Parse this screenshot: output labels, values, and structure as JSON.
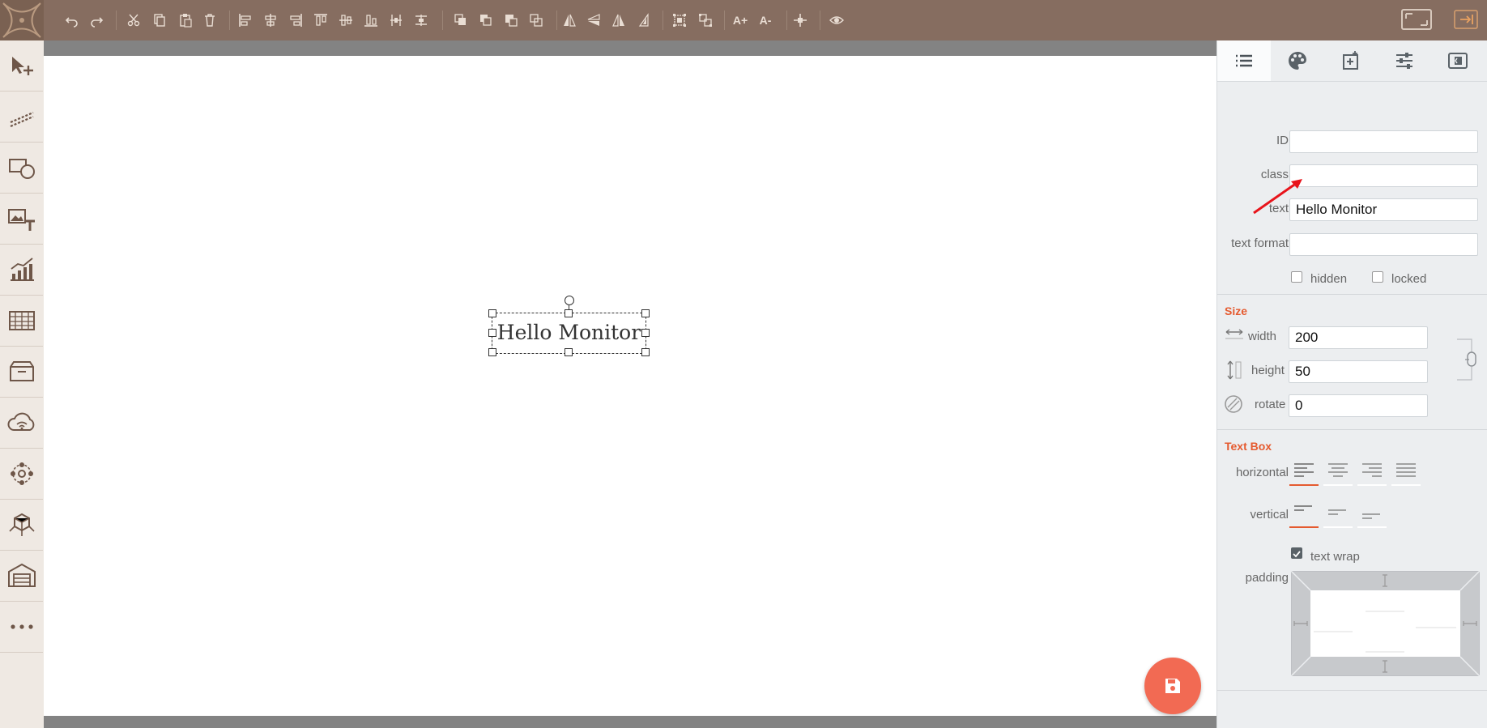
{
  "toolbar": {
    "buttons": [
      "undo-icon",
      "redo-icon",
      "cut-icon",
      "copy-icon",
      "paste-icon",
      "delete-icon",
      "align-left-icon",
      "align-center-icon",
      "align-right-icon",
      "align-top-icon",
      "align-middle-icon",
      "align-bottom-icon",
      "distribute-horizontal-icon",
      "distribute-vertical-icon",
      "bring-to-front-icon",
      "bring-forward-icon",
      "send-backward-icon",
      "send-to-back-icon",
      "flip-horizontal-icon",
      "flip-vertical-icon",
      "mirror-icon",
      "mirror-reverse-icon",
      "group-icon",
      "ungroup-icon",
      "font-increase-icon",
      "font-decrease-icon",
      "crosshair-icon",
      "preview-icon"
    ],
    "font_plus": "A+",
    "font_minus": "A-"
  },
  "leftbar": [
    "pointer-tool-icon",
    "line-tool-icon",
    "shapes-tool-icon",
    "image-text-tool-icon",
    "chart-tool-icon",
    "table-tool-icon",
    "container-tool-icon",
    "cloud-wifi-tool-icon",
    "network-tool-icon",
    "model-3d-tool-icon",
    "warehouse-tool-icon",
    "more-tools-icon"
  ],
  "canvas": {
    "text": "Hello Monitor"
  },
  "panel": {
    "tabs": [
      "list-icon",
      "palette-icon",
      "add-image-icon",
      "sliders-icon",
      "panel-icon"
    ],
    "id_label": "ID",
    "id_value": "",
    "class_label": "class",
    "class_value": "",
    "text_label": "text",
    "text_value": "Hello Monitor",
    "text_format_label": "text format",
    "text_format_value": "",
    "hidden_label": "hidden",
    "locked_label": "locked",
    "size_title": "Size",
    "width_label": "width",
    "width_value": "200",
    "height_label": "height",
    "height_value": "50",
    "rotate_label": "rotate",
    "rotate_value": "0",
    "textbox_title": "Text Box",
    "horizontal_label": "horizontal",
    "vertical_label": "vertical",
    "text_wrap_label": "text wrap",
    "padding_label": "padding"
  },
  "colors": {
    "toolbar": "#866d60",
    "accent": "#e55a2f",
    "fab": "#f26a53",
    "annotation_arrow": "#e8141b"
  }
}
